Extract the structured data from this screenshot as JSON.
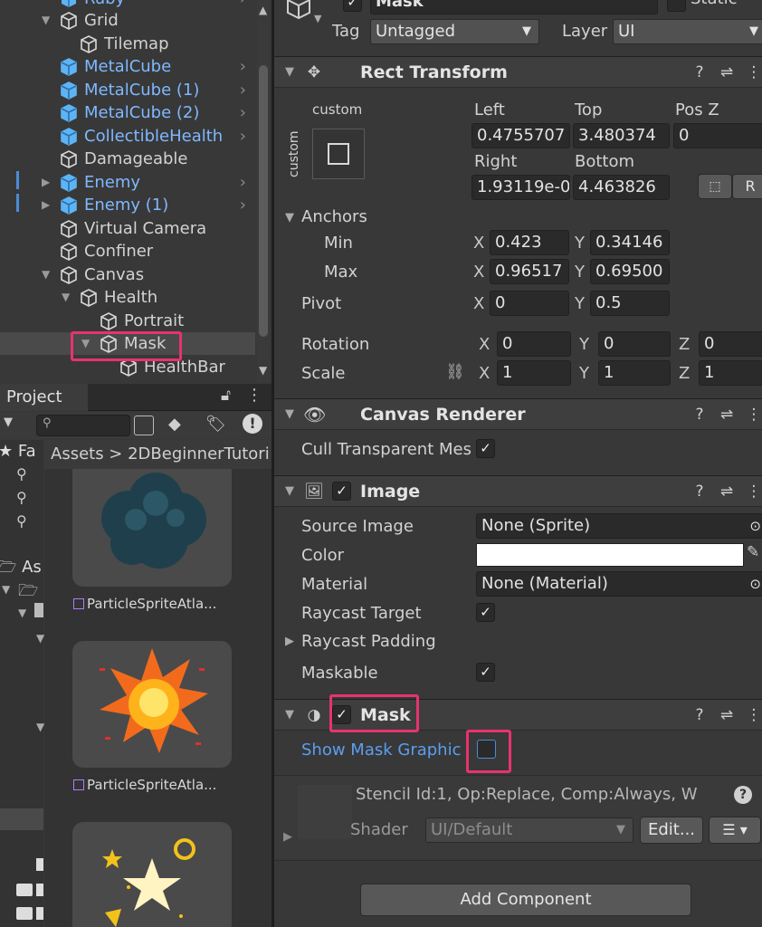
{
  "hierarchy": {
    "top_partial": "Ruby",
    "items": [
      {
        "label": "Grid"
      },
      {
        "label": "Tilemap"
      },
      {
        "label": "MetalCube"
      },
      {
        "label": "MetalCube (1)"
      },
      {
        "label": "MetalCube (2)"
      },
      {
        "label": "CollectibleHealth"
      },
      {
        "label": "Damageable"
      },
      {
        "label": "Enemy"
      },
      {
        "label": "Enemy (1)"
      },
      {
        "label": "Virtual Camera"
      },
      {
        "label": "Confiner"
      },
      {
        "label": "Canvas"
      },
      {
        "label": "Health"
      },
      {
        "label": "Portrait"
      },
      {
        "label": "Mask"
      },
      {
        "label": "HealthBar"
      }
    ]
  },
  "project": {
    "tab_label": "Project",
    "favorites_partial": "Fa",
    "assets_partial": "As",
    "breadcrumb": "Assets  >  2DBeginnerTutori",
    "tiles": [
      "ParticleSpriteAtla...",
      "ParticleSpriteAtla..."
    ]
  },
  "inspector": {
    "object_name": "Mask",
    "static_label": "Static",
    "tag_label": "Tag",
    "tag_value": "Untagged",
    "layer_label": "Layer",
    "layer_value": "UI",
    "rect_transform": {
      "title": "Rect Transform",
      "anchor_preset": "custom",
      "anchor_preset_side": "custom",
      "left_label": "Left",
      "top_label": "Top",
      "posz_label": "Pos Z",
      "left": "0.4755707",
      "top": "3.480374",
      "posz": "0",
      "right_label": "Right",
      "bottom_label": "Bottom",
      "right": "1.93119e-0",
      "bottom": "4.463826",
      "raw_button": "R",
      "anchors_label": "Anchors",
      "min_label": "Min",
      "max_label": "Max",
      "min_x": "0.423",
      "min_y": "0.34146",
      "max_x": "0.96517",
      "max_y": "0.69500",
      "pivot_label": "Pivot",
      "pivot_x": "0",
      "pivot_y": "0.5",
      "rotation_label": "Rotation",
      "rot_x": "0",
      "rot_y": "0",
      "rot_z": "0",
      "scale_label": "Scale",
      "scale_x": "1",
      "scale_y": "1",
      "scale_z": "1",
      "x": "X",
      "y": "Y",
      "z": "Z"
    },
    "canvas_renderer": {
      "title": "Canvas Renderer",
      "cull_label": "Cull Transparent Mes",
      "cull_checked": true
    },
    "image": {
      "title": "Image",
      "source_image_label": "Source Image",
      "source_image": "None (Sprite)",
      "color_label": "Color",
      "color": "#ffffff",
      "material_label": "Material",
      "material": "None (Material)",
      "raycast_target_label": "Raycast Target",
      "raycast_padding_label": "Raycast Padding",
      "maskable_label": "Maskable"
    },
    "mask": {
      "title": "Mask",
      "show_graphic_label": "Show Mask Graphic",
      "show_graphic_checked": false
    },
    "material_preview": {
      "stencil": "Stencil Id:1, Op:Replace, Comp:Always, W",
      "shader_label": "Shader",
      "shader_value": "UI/Default",
      "edit_button": "Edit..."
    },
    "add_component": "Add Component"
  },
  "colors": {
    "accent_highlight": "#e7336f",
    "prefab_blue": "#7fb8ff",
    "link_blue": "#5c9ef0"
  }
}
